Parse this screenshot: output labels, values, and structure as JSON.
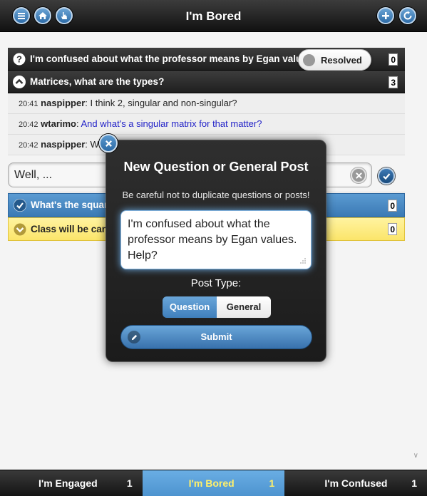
{
  "header": {
    "title": "I'm Bored",
    "left_icons": [
      "menu-icon",
      "home-icon",
      "hand-icon"
    ],
    "right_icons": [
      "plus-icon",
      "refresh-icon"
    ]
  },
  "questions": [
    {
      "icon": "question-icon",
      "text": "I'm confused about what the professor means by Egan values. Help?",
      "count": "0",
      "toggle_label": "Resolved"
    },
    {
      "icon": "chevron-up-icon",
      "text": "Matrices, what are the types?",
      "count": "3",
      "messages": [
        {
          "time": "20:41",
          "user": "naspipper",
          "text": ": I think 2, singular and non-singular?"
        },
        {
          "time": "20:42",
          "user": "wtarimo",
          "text": "And what's a singular matrix for that matter?"
        },
        {
          "time": "20:42",
          "user": "naspipper",
          "text": ": What's a matrix?"
        }
      ],
      "reply_value": "Well, ..."
    },
    {
      "icon": "check-icon",
      "text": "What's the square root of negative one?",
      "count": "0"
    },
    {
      "icon": "chevron-down-icon",
      "text": "Class will be cancelled tomorrow, right?",
      "count": "0"
    }
  ],
  "dialog": {
    "title": "New Question or General Post",
    "warning": "Be careful not to duplicate questions or posts!",
    "textarea_value": "I'm confused about what the professor means by Egan values. Help?",
    "post_type_label": "Post Type:",
    "post_types": [
      "Question",
      "General"
    ],
    "selected_post_type": "Question",
    "submit_label": "Submit"
  },
  "footer": {
    "tabs": [
      {
        "label": "I'm Engaged",
        "count": "1"
      },
      {
        "label": "I'm Bored",
        "count": "1",
        "active": true
      },
      {
        "label": "I'm Confused",
        "count": "1"
      }
    ]
  },
  "colors": {
    "accent_blue": "#4a8bc6",
    "highlight_yellow": "#fbe56a",
    "active_tab_text": "#fff06a"
  }
}
